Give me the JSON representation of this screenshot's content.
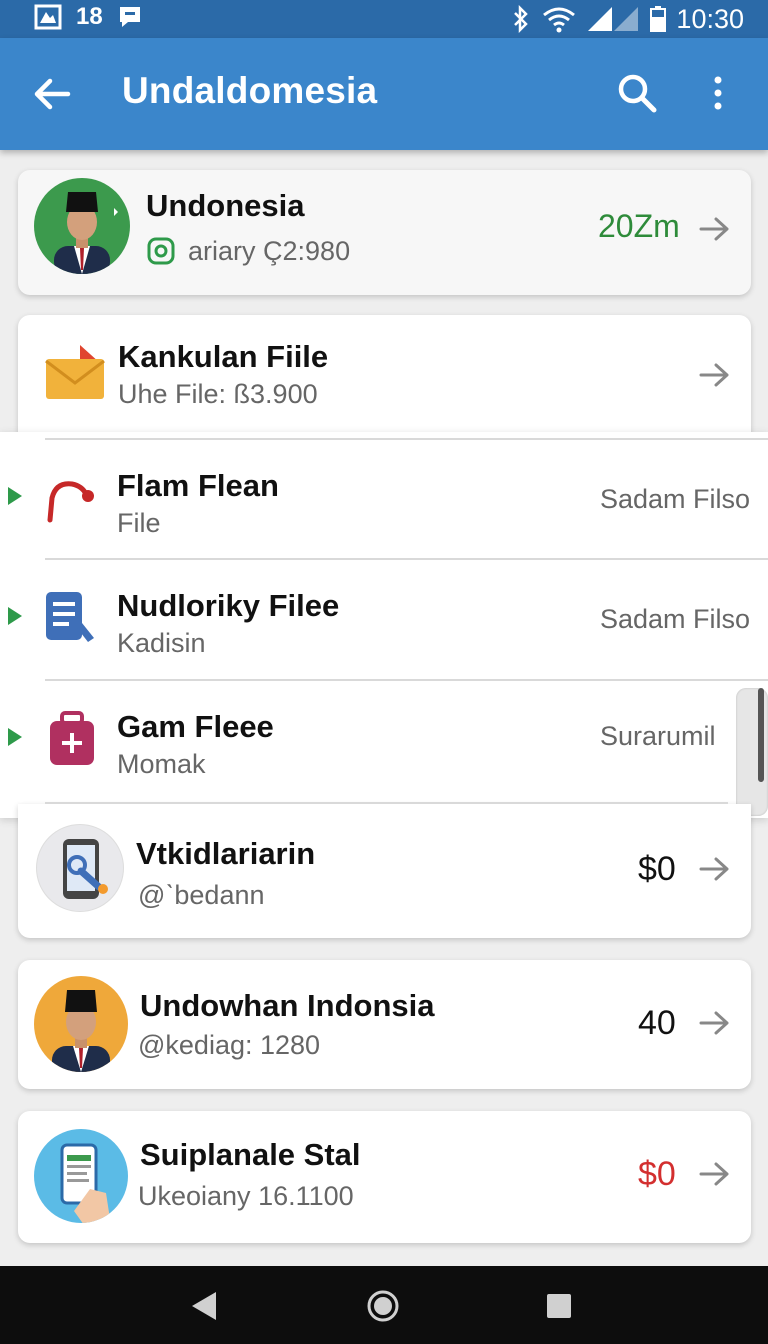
{
  "status_bar": {
    "time": "10:30",
    "notification_count": "18"
  },
  "app_bar": {
    "title": "Undaldomesia"
  },
  "profile_card": {
    "name": "Undonesia",
    "subtitle": "ariary Ç2:980",
    "value": "20Zm",
    "value_color": "#2e8b3a"
  },
  "file_card": {
    "title": "Kankulan Fiile",
    "subtitle": "Uhe File: ß3.900"
  },
  "panel_items": [
    {
      "title": "Flam Flean",
      "subtitle": "File",
      "right": "Sadam Filso"
    },
    {
      "title": "Nudloriky Filee",
      "subtitle": "Kadisin",
      "right": "Sadam Filso"
    },
    {
      "title": "Gam Fleee",
      "subtitle": "Momak",
      "right": "Surarumil"
    }
  ],
  "list_cards": [
    {
      "title": "Vtkidlariarin",
      "subtitle": "@ˋbedann",
      "value": "$0",
      "value_color": "#111111"
    },
    {
      "title": "Undowhan Indonsia",
      "subtitle": "@kediag: 1280",
      "value": "40",
      "value_color": "#111111"
    },
    {
      "title": "Suiplanale Stal",
      "subtitle": "Ukeoiany 16.1100",
      "value": "$0",
      "value_color": "#d32f2f"
    }
  ],
  "colors": {
    "status_bar": "#2b6aa8",
    "app_bar": "#3b86cb",
    "accent_green": "#2e9a4a",
    "accent_red": "#d32f2f"
  }
}
